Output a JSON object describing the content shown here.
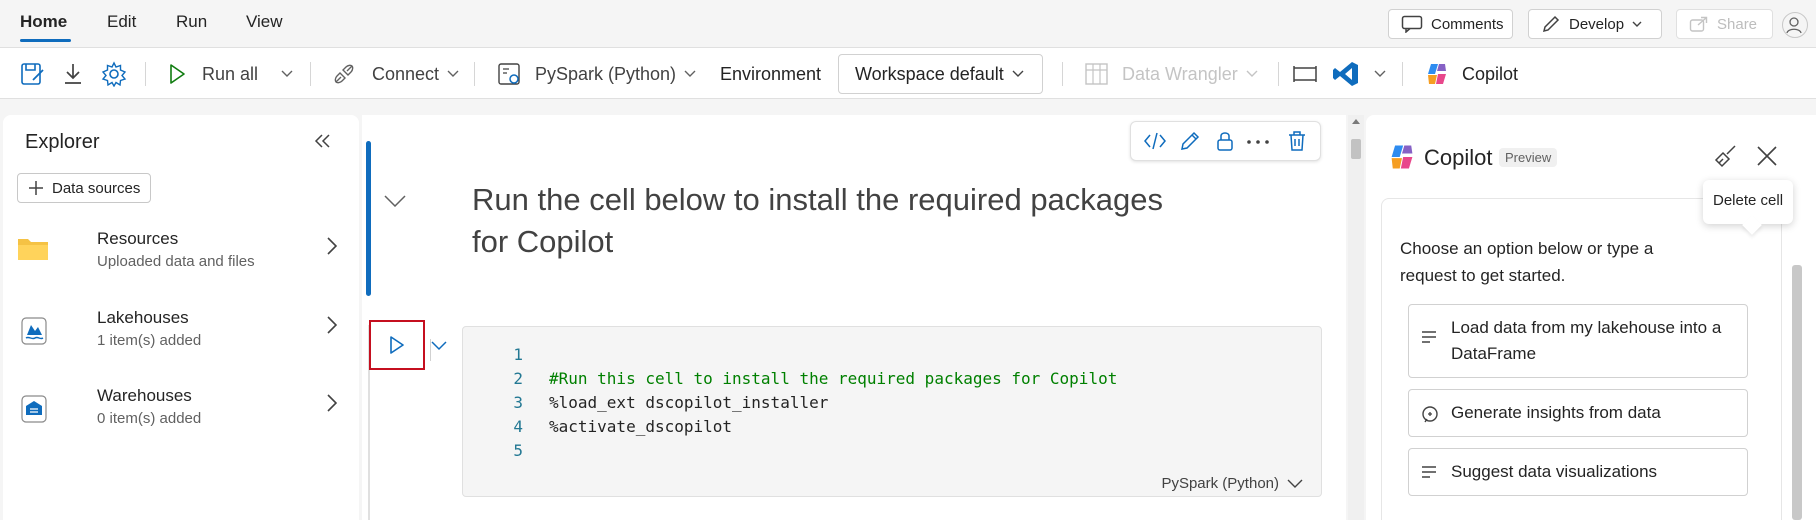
{
  "menu": {
    "tabs": [
      {
        "label": "Home",
        "active": true
      },
      {
        "label": "Edit",
        "active": false
      },
      {
        "label": "Run",
        "active": false
      },
      {
        "label": "View",
        "active": false
      }
    ],
    "comments_label": "Comments",
    "develop_label": "Develop",
    "share_label": "Share"
  },
  "toolbar": {
    "run_all_label": "Run all",
    "connect_label": "Connect",
    "kernel_label": "PySpark (Python)",
    "environment_label": "Environment",
    "workspace_label": "Workspace default",
    "data_wrangler_label": "Data Wrangler",
    "copilot_label": "Copilot"
  },
  "explorer": {
    "title": "Explorer",
    "data_sources_label": "Data sources",
    "items": [
      {
        "label": "Resources",
        "sub": "Uploaded data and files",
        "icon": "folder-icon"
      },
      {
        "label": "Lakehouses",
        "sub": "1 item(s) added",
        "icon": "lakehouse-icon"
      },
      {
        "label": "Warehouses",
        "sub": "0 item(s) added",
        "icon": "warehouse-icon"
      }
    ]
  },
  "notebook": {
    "markdown_text": "Run the cell below to install the required packages for Copilot",
    "code_lines": [
      {
        "n": "1",
        "text": ""
      },
      {
        "n": "2",
        "text": "#Run this cell to install the required packages for Copilot"
      },
      {
        "n": "3",
        "text": "%load_ext dscopilot_installer"
      },
      {
        "n": "4",
        "text": "%activate_dscopilot"
      },
      {
        "n": "5",
        "text": ""
      }
    ],
    "language_label": "PySpark (Python)"
  },
  "copilot": {
    "title": "Copilot",
    "badge": "Preview",
    "tooltip": "Delete cell",
    "intro": "Choose an option below or type a request to get started.",
    "suggestions": [
      "Load data from my lakehouse into a DataFrame",
      "Generate insights from data",
      "Suggest data visualizations"
    ]
  },
  "colors": {
    "accent": "#0f6cbd",
    "highlight_border": "#c50f1f",
    "code_comment": "#008000"
  }
}
